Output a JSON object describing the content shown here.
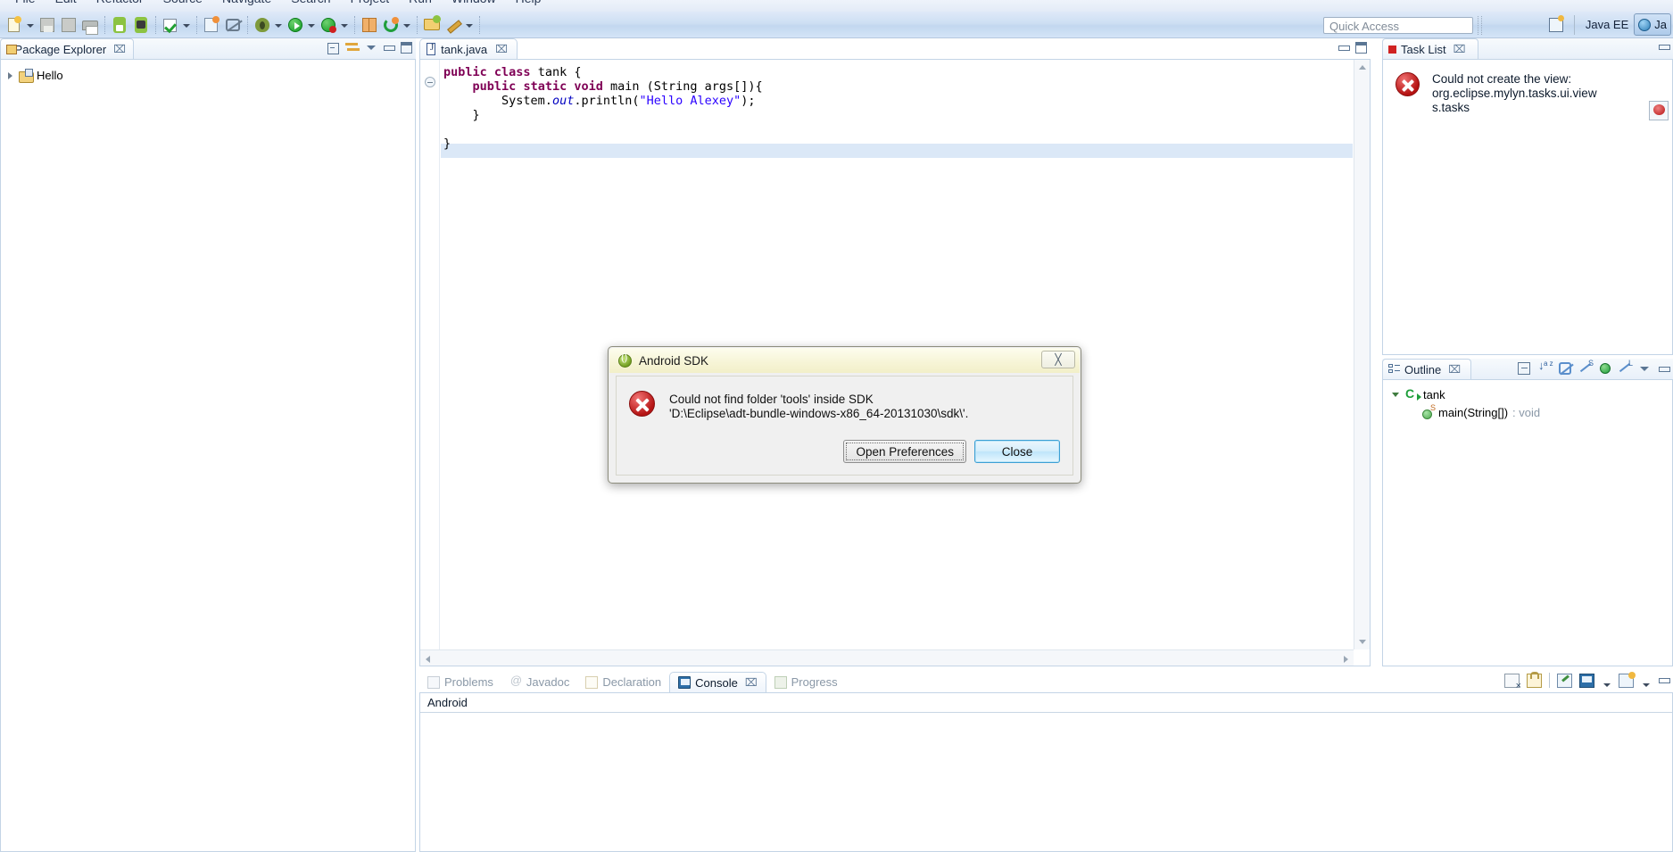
{
  "menubar": {
    "items": [
      "File",
      "Edit",
      "Refactor",
      "Source",
      "Navigate",
      "Search",
      "Project",
      "Run",
      "Window",
      "Help"
    ]
  },
  "toolbar": {
    "icons": [
      "new-document-icon",
      "save-icon",
      "save-all-icon",
      "print-icon",
      "android-sdk-manager-icon",
      "android-avd-manager-icon",
      "validate-icon",
      "new-android-project-icon",
      "skip-breakpoints-icon",
      "debug-icon",
      "run-icon",
      "run-last-tool-icon",
      "new-java-project-icon",
      "new-annotation-icon",
      "open-resource-icon",
      "edit-icon"
    ]
  },
  "quick_access": {
    "placeholder": "Quick Access",
    "value": ""
  },
  "perspective": {
    "open_perspective_icon": "open-perspective-icon",
    "java_ee_label": "Java EE",
    "java_label": "Ja"
  },
  "package_explorer": {
    "title": "Package Explorer",
    "close_glyph": "⌧",
    "tools": [
      "collapse-all-icon",
      "link-with-editor-icon",
      "view-menu-icon",
      "minimize-icon",
      "maximize-icon"
    ],
    "tree": [
      {
        "label": "Hello",
        "icon": "java-project-icon",
        "expanded": false
      }
    ]
  },
  "editor": {
    "tab": {
      "label": "tank.java",
      "icon": "java-file-icon",
      "close_glyph": "⌧"
    },
    "tools": [
      "minimize-icon",
      "maximize-icon"
    ],
    "fold_marker": "collapse-fold-icon",
    "code_lines": [
      {
        "id": "l1",
        "indent": 0,
        "tokens": [
          {
            "t": "public",
            "c": "kw"
          },
          {
            "t": " ",
            "c": ""
          },
          {
            "t": "class",
            "c": "kw"
          },
          {
            "t": " tank {",
            "c": ""
          }
        ]
      },
      {
        "id": "l2",
        "indent": 1,
        "tokens": [
          {
            "t": "public",
            "c": "kw"
          },
          {
            "t": " ",
            "c": ""
          },
          {
            "t": "static",
            "c": "kw"
          },
          {
            "t": " ",
            "c": ""
          },
          {
            "t": "void",
            "c": "kw"
          },
          {
            "t": " main (String args[]){",
            "c": ""
          }
        ]
      },
      {
        "id": "l3",
        "indent": 2,
        "tokens": [
          {
            "t": "System.",
            "c": ""
          },
          {
            "t": "out",
            "c": "fld"
          },
          {
            "t": ".println(",
            "c": ""
          },
          {
            "t": "\"Hello Alexey\"",
            "c": "str"
          },
          {
            "t": ");",
            "c": ""
          }
        ]
      },
      {
        "id": "l4",
        "indent": 1,
        "tokens": [
          {
            "t": "}",
            "c": ""
          }
        ]
      },
      {
        "id": "l5",
        "indent": 0,
        "tokens": [
          {
            "t": "",
            "c": ""
          }
        ]
      },
      {
        "id": "l6",
        "indent": 0,
        "tokens": [
          {
            "t": "}",
            "c": ""
          }
        ]
      }
    ],
    "plain_text": "public class tank {\n    public static void main (String args[]){\n        System.out.println(\"Hello Alexey\");\n    }\n\n}"
  },
  "console_view": {
    "tabs": [
      {
        "label": "Problems",
        "icon": "problems-icon",
        "active": false
      },
      {
        "label": "Javadoc",
        "icon": "javadoc-icon",
        "active": false
      },
      {
        "label": "Declaration",
        "icon": "declaration-icon",
        "active": false
      },
      {
        "label": "Console",
        "icon": "console-icon",
        "active": true,
        "close_glyph": "⌧"
      },
      {
        "label": "Progress",
        "icon": "progress-icon",
        "active": false
      }
    ],
    "title": "Android",
    "body_text": "",
    "tools": [
      "clear-console-icon",
      "scroll-lock-icon",
      "pin-console-icon",
      "display-selected-console-icon",
      "open-console-icon",
      "minimize-icon"
    ]
  },
  "task_list": {
    "title": "Task List",
    "close_glyph": "⌧",
    "error_icon": "error-icon",
    "message_lines": [
      "Could not create the view:",
      "org.eclipse.mylyn.tasks.ui.view",
      "s.tasks"
    ],
    "message_full": "Could not create the view: org.eclipse.mylyn.tasks.ui.views.tasks",
    "side_button_icon": "error-log-icon",
    "tools": [
      "minimize-icon"
    ]
  },
  "outline": {
    "title": "Outline",
    "close_glyph": "⌧",
    "tools": [
      "collapse-all-icon",
      "sort-icon",
      "hide-fields-icon",
      "hide-static-icon",
      "show-public-icon",
      "hide-local-types-icon",
      "view-menu-icon",
      "minimize-icon"
    ],
    "tree": [
      {
        "label": "tank",
        "icon": "class-icon",
        "expanded": true,
        "indent": 0,
        "return_type": ""
      },
      {
        "label": "main(String[])",
        "icon": "method-icon",
        "expanded": false,
        "indent": 1,
        "return_type": " : void"
      }
    ]
  },
  "dialog": {
    "title": "Android SDK",
    "app_icon": "android-sdk-icon",
    "close_glyph": "╳",
    "error_icon": "error-icon",
    "message_line1": "Could not find folder 'tools' inside SDK",
    "message_line2": "'D:\\Eclipse\\adt-bundle-windows-x86_64-20131030\\sdk\\'.",
    "buttons": [
      {
        "label": "Open Preferences",
        "default": false,
        "focused": true
      },
      {
        "label": "Close",
        "default": true,
        "focused": false
      }
    ]
  },
  "colors": {
    "accent_blue": "#2e6fa8",
    "error_red": "#b51414",
    "keyword_purple": "#7f0055",
    "string_blue": "#2a00ff",
    "field_blue": "#0000c0",
    "android_green": "#8cc342",
    "dialog_title_bg": "#f7f5d8",
    "toolbar_bg": "#cddff3",
    "selected_line": "#dbe8f7"
  }
}
